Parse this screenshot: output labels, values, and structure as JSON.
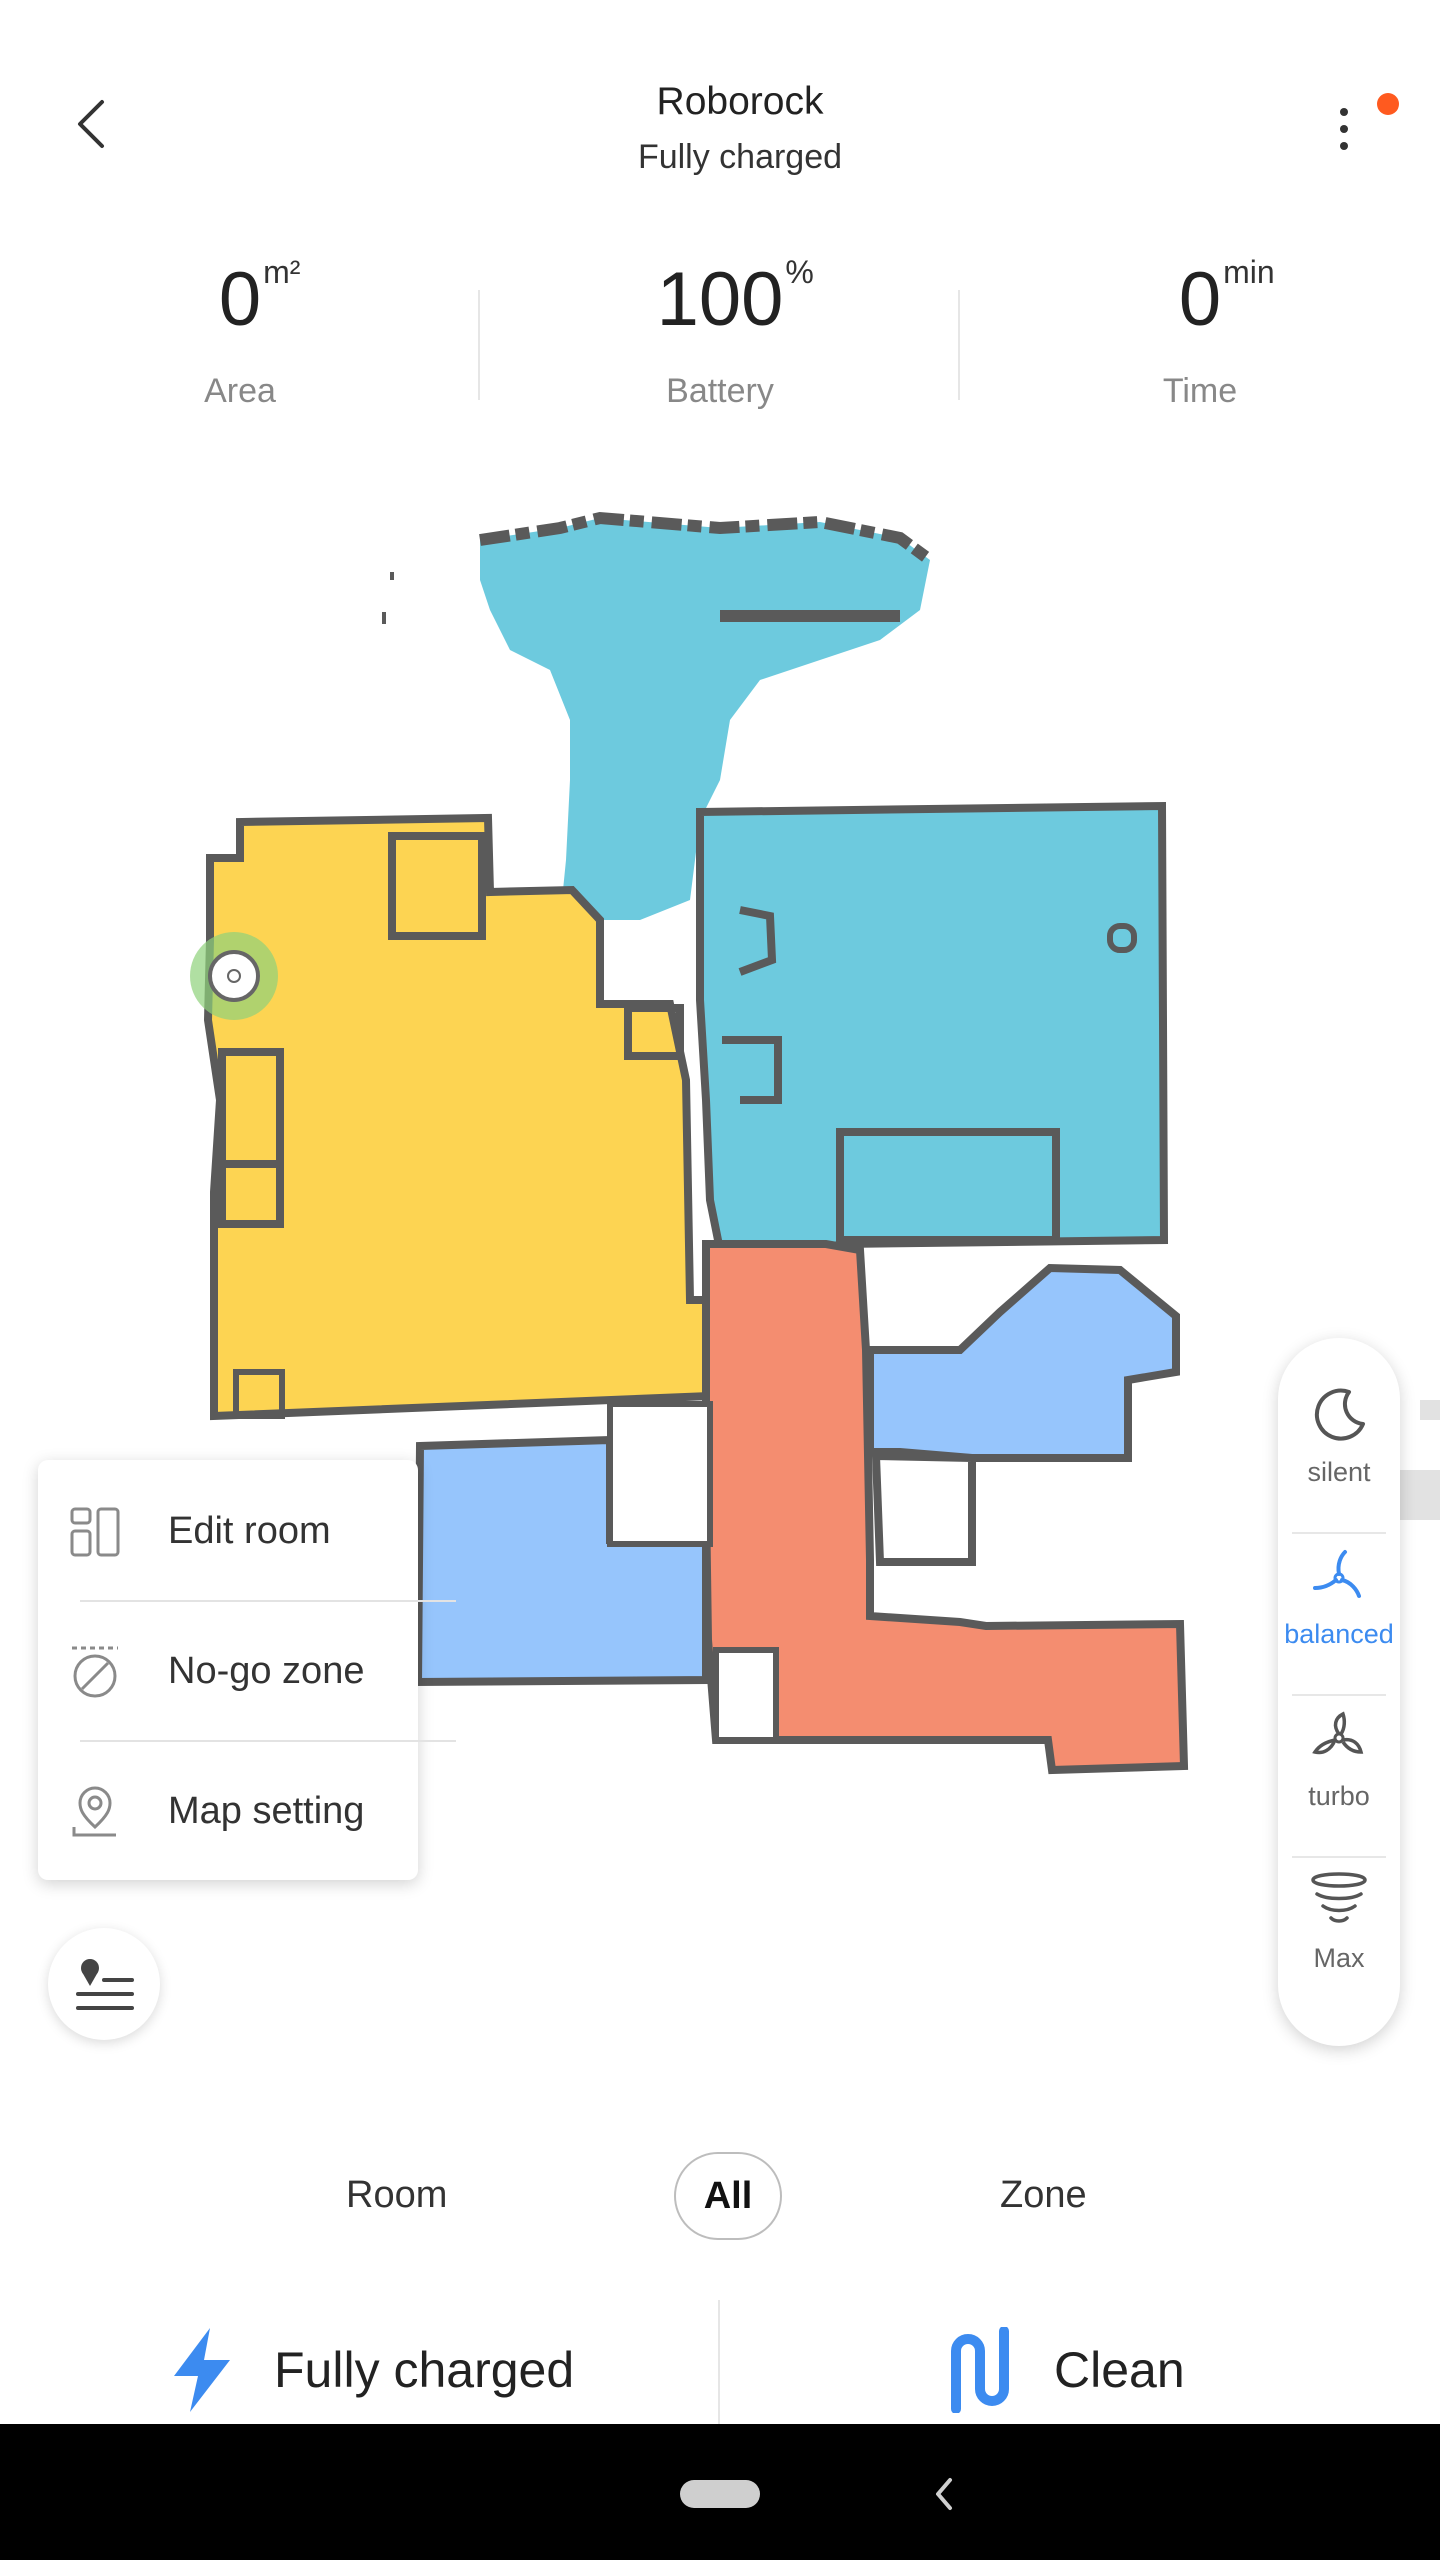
{
  "header": {
    "title": "Roborock",
    "subtitle": "Fully charged"
  },
  "stats": [
    {
      "value": "0",
      "unit": "m²",
      "label": "Area"
    },
    {
      "value": "100",
      "unit": "%",
      "label": "Battery"
    },
    {
      "value": "0",
      "unit": "min",
      "label": "Time"
    }
  ],
  "map_menu": {
    "items": [
      {
        "label": "Edit room",
        "icon": "edit-room-icon"
      },
      {
        "label": "No-go zone",
        "icon": "no-go-zone-icon"
      },
      {
        "label": "Map setting",
        "icon": "map-setting-icon"
      }
    ]
  },
  "suction": {
    "modes": [
      {
        "label": "silent",
        "icon": "moon-icon"
      },
      {
        "label": "balanced",
        "icon": "fan-icon",
        "active": true
      },
      {
        "label": "turbo",
        "icon": "fan-turbo-icon"
      },
      {
        "label": "Max",
        "icon": "tornado-icon"
      }
    ]
  },
  "mode_tabs": {
    "room": "Room",
    "all": "All",
    "zone": "Zone",
    "selected": "All"
  },
  "actions": {
    "dock_label": "Fully charged",
    "clean_label": "Clean"
  },
  "colors": {
    "accent_blue": "#3C8BF0",
    "notification": "#FF5A1F",
    "room_yellow": "#FDD452",
    "room_cyan": "#6DCADE",
    "room_light_blue": "#96C5FC",
    "room_salmon": "#F48D70",
    "wall": "#5A5A5A"
  }
}
